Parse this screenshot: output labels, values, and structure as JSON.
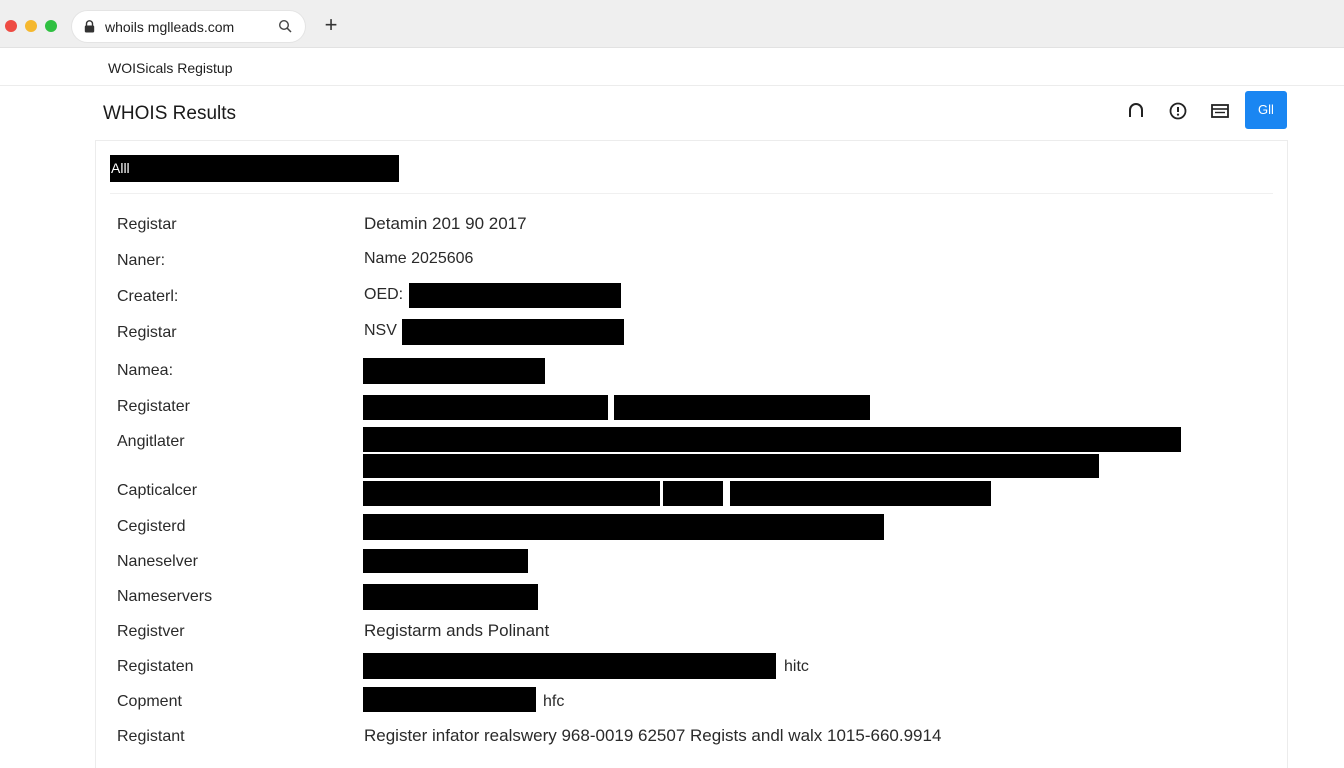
{
  "browser": {
    "url": "whoils mglleads.com",
    "new_tab_label": "+"
  },
  "site": {
    "title": "WOISicals Registup"
  },
  "page": {
    "title": "WHOIS Results",
    "primary_button_label": "Gll",
    "accent_color": "#1a86f2"
  },
  "toolbar": {
    "icons": [
      "headphones-icon",
      "alert-circle-icon",
      "inbox-icon"
    ]
  },
  "card": {
    "heading": "Alll"
  },
  "records": [
    {
      "label": "Registar",
      "value": "Detamin 201 90 2017"
    },
    {
      "label": "Naner:",
      "value": "Name 2025606"
    },
    {
      "label": "Createrl:",
      "value": "OED:"
    },
    {
      "label": "Registar",
      "value": "NSV"
    },
    {
      "label": "Namea:",
      "value": ""
    },
    {
      "label": "Registater",
      "value": ""
    },
    {
      "label": "Angitlater",
      "value": ""
    },
    {
      "label": "Capticalcer",
      "value": ""
    },
    {
      "label": "Cegisterd",
      "value": ""
    },
    {
      "label": "Naneselver",
      "value": ""
    },
    {
      "label": "Nameservers",
      "value": ""
    },
    {
      "label": "Registver",
      "value": "Registarm ands Polinant"
    },
    {
      "label": "Registaten",
      "value": "",
      "suffix": "hitc"
    },
    {
      "label": "Copment",
      "value": "",
      "suffix": "hfc"
    },
    {
      "label": "Registant",
      "value": "Register infator realswery 968-0019 62507 Regists andl walx 1015-660.9914"
    }
  ]
}
